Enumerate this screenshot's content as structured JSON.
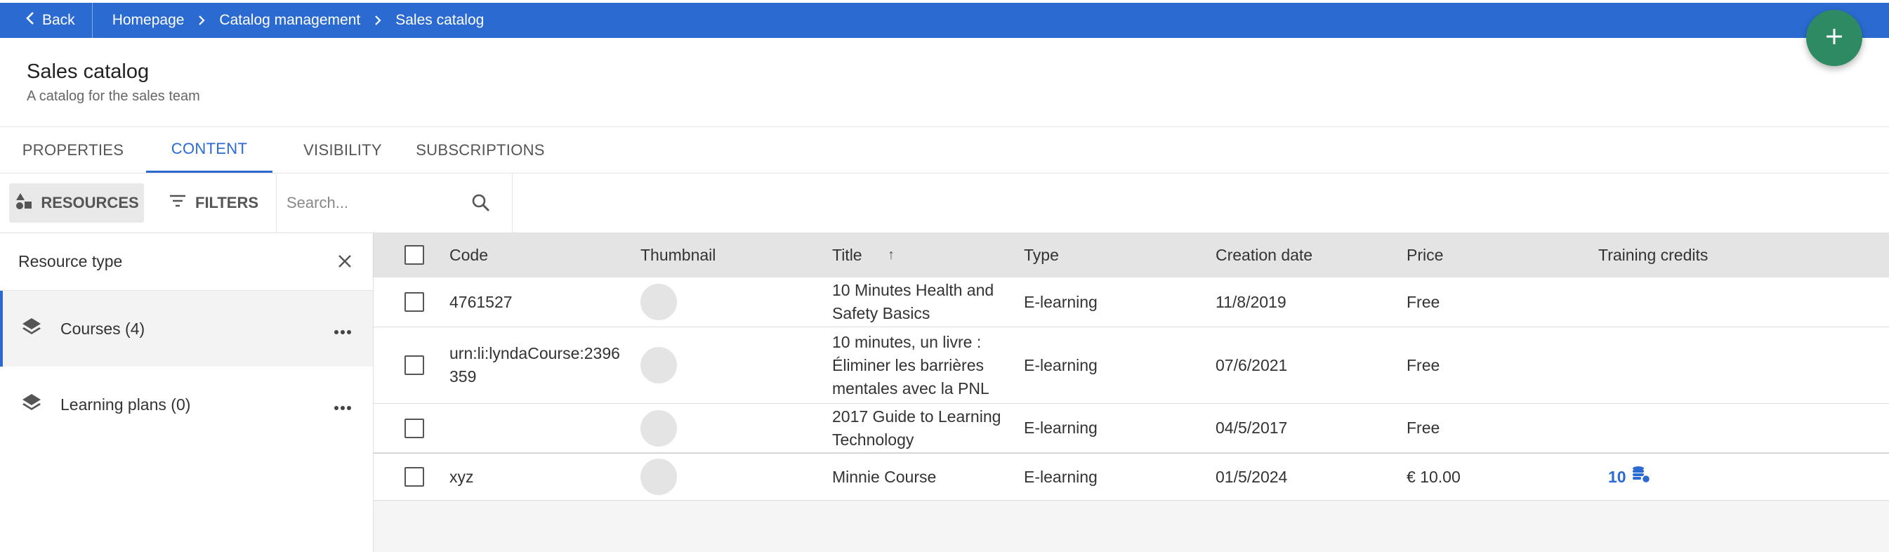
{
  "topbar": {
    "back_label": "Back",
    "breadcrumbs": [
      "Homepage",
      "Catalog management",
      "Sales catalog"
    ]
  },
  "header": {
    "title": "Sales catalog",
    "subtitle": "A catalog for the sales team"
  },
  "tabs": [
    {
      "label": "PROPERTIES",
      "active": false
    },
    {
      "label": "CONTENT",
      "active": true
    },
    {
      "label": "VISIBILITY",
      "active": false
    },
    {
      "label": "SUBSCRIPTIONS",
      "active": false
    }
  ],
  "toolbar": {
    "resources_label": "RESOURCES",
    "filters_label": "FILTERS",
    "search_placeholder": "Search..."
  },
  "left_panel": {
    "title": "Resource type",
    "items": [
      {
        "label": "Courses (4)",
        "selected": true
      },
      {
        "label": "Learning plans (0)",
        "selected": false
      }
    ]
  },
  "table": {
    "columns": [
      "Code",
      "Thumbnail",
      "Title",
      "Type",
      "Creation date",
      "Price",
      "Training credits"
    ],
    "sort_indicator": "↑",
    "rows": [
      {
        "code": "4761527",
        "title": "10 Minutes Health and Safety Basics",
        "type": "E-learning",
        "date": "11/8/2019",
        "price": "Free",
        "credits": ""
      },
      {
        "code": "urn:li:lyndaCourse:2396359",
        "title": "10 minutes, un livre : Éliminer les barrières mentales avec la PNL",
        "type": "E-learning",
        "date": "07/6/2021",
        "price": "Free",
        "credits": ""
      },
      {
        "code": "",
        "title": "2017 Guide to Learning Technology",
        "type": "E-learning",
        "date": "04/5/2017",
        "price": "Free",
        "credits": ""
      },
      {
        "code": "xyz",
        "title": "Minnie Course",
        "type": "E-learning",
        "date": "01/5/2024",
        "price": "€ 10.00",
        "credits": "10"
      }
    ]
  },
  "colors": {
    "brand_blue": "#2b6bd1",
    "fab_green": "#2d8a63"
  }
}
